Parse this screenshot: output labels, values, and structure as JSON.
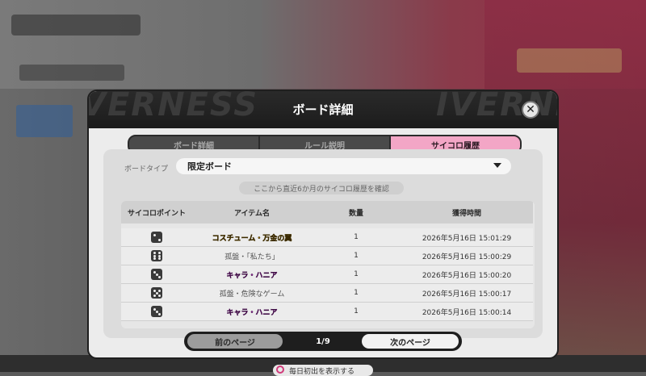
{
  "dialog": {
    "title": "ボード詳細",
    "header_deco_left": "VERNESS",
    "header_deco_right": "IVERNES",
    "close_glyph": "✕"
  },
  "tabs": [
    {
      "label": "ボード詳細",
      "active": false
    },
    {
      "label": "ルール説明",
      "active": false
    },
    {
      "label": "サイコロ履歴",
      "active": true
    }
  ],
  "filter": {
    "label": "ボードタイプ",
    "value": "限定ボード"
  },
  "hint": "ここから直近6か月のサイコロ履歴を確認",
  "table": {
    "headers": [
      "サイコロポイント",
      "アイテム名",
      "数量",
      "獲得時間"
    ],
    "rows": [
      {
        "dice": 2,
        "item": "コスチューム・万金の翼",
        "style": "gold",
        "qty": "1",
        "time": "2026年5月16日 15:01:29"
      },
      {
        "dice": 6,
        "item": "孤盤・「私たち」",
        "style": "normal",
        "qty": "1",
        "time": "2026年5月16日 15:00:29"
      },
      {
        "dice": 3,
        "item": "キャラ・ハニア",
        "style": "purple",
        "qty": "1",
        "time": "2026年5月16日 15:00:20"
      },
      {
        "dice": 5,
        "item": "孤盤・危険なゲーム",
        "style": "normal",
        "qty": "1",
        "time": "2026年5月16日 15:00:17"
      },
      {
        "dice": 3,
        "item": "キャラ・ハニア",
        "style": "purple",
        "qty": "1",
        "time": "2026年5月16日 15:00:14"
      }
    ]
  },
  "pager": {
    "prev": "前のページ",
    "page": "1/9",
    "next": "次のページ"
  },
  "bottom": {
    "label": "毎日初出を表示する"
  },
  "colors": {
    "active_tab": "#f3a6c6",
    "gold_item": "#e2a400",
    "purple_item": "#c43ad0"
  }
}
